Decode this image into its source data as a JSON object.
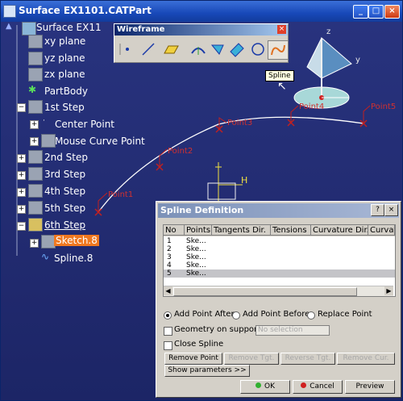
{
  "window": {
    "title": "Surface EX1101.CATPart"
  },
  "tree": {
    "root": "Surface EX11",
    "items": [
      {
        "label": "xy plane"
      },
      {
        "label": "yz plane"
      },
      {
        "label": "zx plane"
      },
      {
        "label": "PartBody"
      },
      {
        "label": "1st Step"
      },
      {
        "label": "Center Point"
      },
      {
        "label": "Mouse Curve Point"
      },
      {
        "label": "2nd Step"
      },
      {
        "label": "3rd Step"
      },
      {
        "label": "4th Step"
      },
      {
        "label": "5th Step"
      },
      {
        "label": "6th Step"
      },
      {
        "label": "Sketch.8"
      },
      {
        "label": "Spline.8"
      }
    ]
  },
  "toolbar": {
    "title": "Wireframe",
    "close": "×",
    "tooltip": "Spline"
  },
  "curve": {
    "points": [
      "Point1",
      "Point2",
      "Point3",
      "Point4",
      "Point5"
    ],
    "axis_h": "H"
  },
  "compass": {
    "z": "z",
    "y": "y"
  },
  "dialog": {
    "title": "Spline Definition",
    "columns": [
      "No",
      "Points",
      "Tangents Dir.",
      "Tensions",
      "Curvature Dir.",
      "Curvatu"
    ],
    "rows": [
      {
        "no": "1",
        "point": "Ske..."
      },
      {
        "no": "2",
        "point": "Ske..."
      },
      {
        "no": "3",
        "point": "Ske..."
      },
      {
        "no": "4",
        "point": "Ske..."
      },
      {
        "no": "5",
        "point": "Ske..."
      }
    ],
    "selected_row": 5,
    "radio_after": "Add Point After",
    "radio_before": "Add Point Before",
    "radio_replace": "Replace Point",
    "geometry_on_support": "Geometry on support",
    "no_selection": "No selection",
    "close_spline": "Close Spline",
    "buttons": {
      "remove_point": "Remove Point",
      "remove_tgt": "Remove Tgt.",
      "reverse_tgt": "Reverse Tgt.",
      "remove_cur": "Remove Cur.",
      "show_params": "Show parameters >>",
      "ok": "OK",
      "cancel": "Cancel",
      "preview": "Preview"
    }
  }
}
